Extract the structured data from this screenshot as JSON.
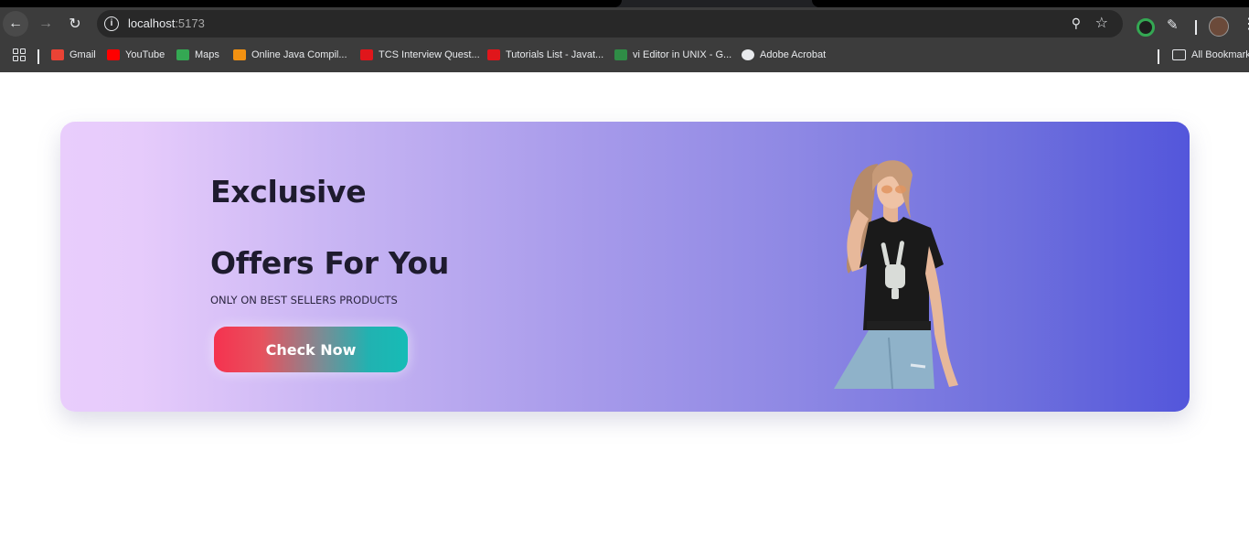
{
  "browser": {
    "url_host": "localhost",
    "url_port": ":5173"
  },
  "bookmarks": [
    {
      "label": "Gmail",
      "color": "#ea4335"
    },
    {
      "label": "YouTube",
      "color": "#ff0000"
    },
    {
      "label": "Maps",
      "color": "#34a853"
    },
    {
      "label": "Online Java Compil...",
      "color": "#f29111"
    },
    {
      "label": "TCS Interview Quest...",
      "color": "#e0161b"
    },
    {
      "label": "Tutorials List - Javat...",
      "color": "#e0161b"
    },
    {
      "label": "vi Editor in UNIX - G...",
      "color": "#2f8d46"
    },
    {
      "label": "Adobe Acrobat",
      "color": "#e8eaed"
    }
  ],
  "all_bookmarks_label": "All Bookmarks",
  "banner": {
    "headline_line1": "Exclusive",
    "headline_line2": "Offers For You",
    "subtitle": "ONLY ON BEST SELLERS PRODUCTS",
    "cta_label": "Check Now"
  },
  "colors": {
    "gradient_start": "#e9cdfc",
    "gradient_end": "#5356db",
    "cta_start": "#f5324f",
    "cta_end": "#16bcb6",
    "headline": "#1e1b2e"
  },
  "icons": {
    "back": "arrow-left-icon",
    "forward": "arrow-right-icon",
    "reload": "reload-icon",
    "site_info": "info-icon",
    "zoom": "zoom-icon",
    "bookmark_star": "star-icon",
    "extensions": "puzzle-icon",
    "menu": "kebab-menu-icon"
  }
}
